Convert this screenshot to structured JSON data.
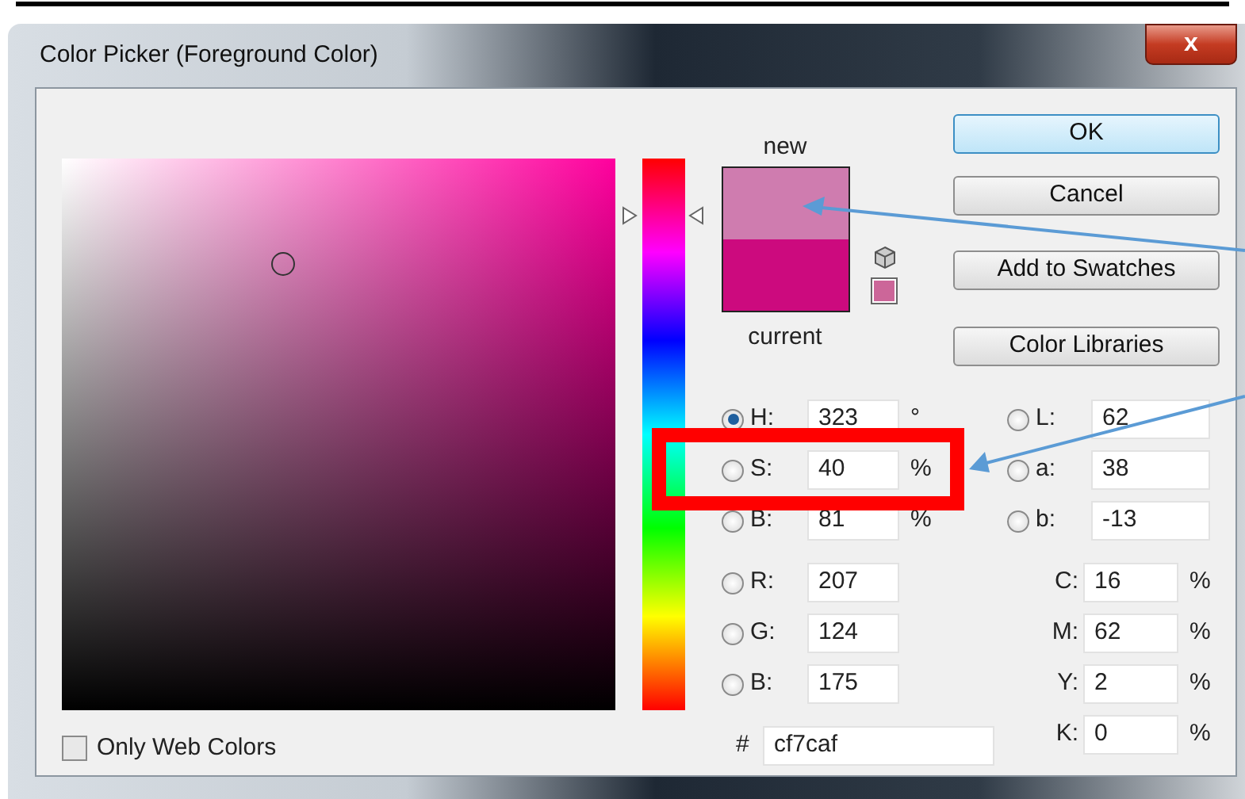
{
  "window": {
    "title": "Color Picker (Foreground Color)",
    "close_label": "x"
  },
  "swatches": [
    {
      "label": "new",
      "color": "#cf7caf"
    },
    {
      "label": "current",
      "color": "#cc0a7e"
    }
  ],
  "buttons": [
    {
      "label": "OK",
      "default": true
    },
    {
      "label": "Cancel",
      "default": false
    },
    {
      "label": "Add to Swatches",
      "default": false
    },
    {
      "label": "Color Libraries",
      "default": false
    }
  ],
  "hsb": [
    {
      "label": "H:",
      "value": "323",
      "unit": "°",
      "selected": true
    },
    {
      "label": "S:",
      "value": "40",
      "unit": "%",
      "selected": false
    },
    {
      "label": "B:",
      "value": "81",
      "unit": "%",
      "selected": false
    }
  ],
  "rgb": [
    {
      "label": "R:",
      "value": "207",
      "selected": false
    },
    {
      "label": "G:",
      "value": "124",
      "selected": false
    },
    {
      "label": "B:",
      "value": "175",
      "selected": false
    }
  ],
  "lab": [
    {
      "label": "L:",
      "value": "62",
      "selected": false
    },
    {
      "label": "a:",
      "value": "38",
      "selected": false
    },
    {
      "label": "b:",
      "value": "-13",
      "selected": false
    }
  ],
  "cmyk": [
    {
      "label": "C:",
      "value": "16",
      "unit": "%"
    },
    {
      "label": "M:",
      "value": "62",
      "unit": "%"
    },
    {
      "label": "Y:",
      "value": "2",
      "unit": "%"
    },
    {
      "label": "K:",
      "value": "0",
      "unit": "%"
    }
  ],
  "hex": {
    "prefix": "#",
    "value": "cf7caf"
  },
  "only_web_colors": {
    "label": "Only Web Colors",
    "checked": false
  }
}
